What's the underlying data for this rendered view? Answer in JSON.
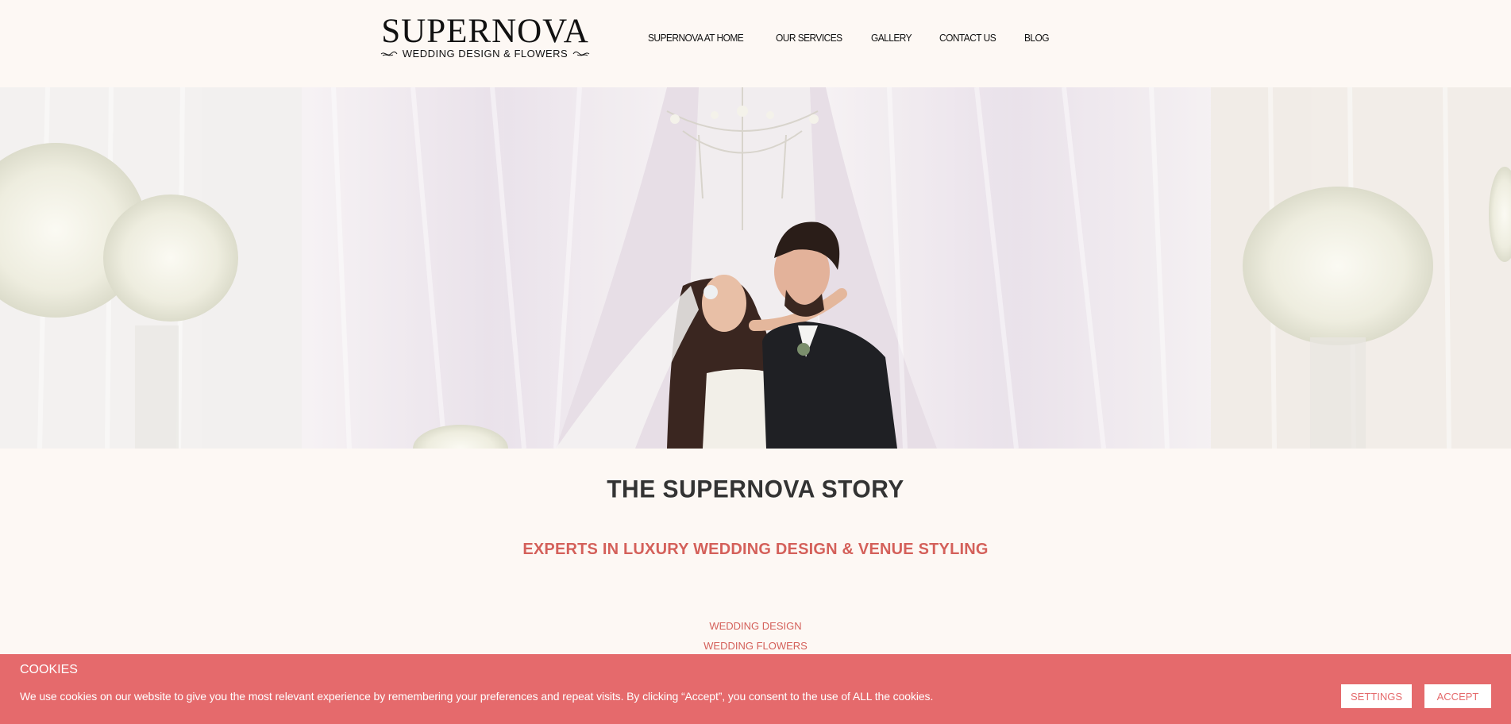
{
  "header": {
    "logo": {
      "main": "SUPERNOVA",
      "sub": "WEDDING DESIGN & FLOWERS"
    },
    "nav": [
      {
        "label": "SUPERNOVA AT HOME"
      },
      {
        "label": "OUR SERVICES"
      },
      {
        "label": "GALLERY"
      },
      {
        "label": "CONTACT US"
      },
      {
        "label": "BLOG"
      }
    ]
  },
  "hero": {
    "image": "wedding-couple-photo"
  },
  "main": {
    "title": "THE SUPERNOVA STORY",
    "subtitle": "EXPERTS IN LUXURY WEDDING DESIGN & VENUE STYLING",
    "services": [
      "WEDDING DESIGN",
      "WEDDING FLOWERS"
    ]
  },
  "cookie": {
    "title": "COOKIES",
    "text": "We use cookies on our website to give you the most relevant experience by remembering your preferences and repeat visits. By clicking “Accept”, you consent to the use of ALL the cookies.",
    "settings_label": "SETTINGS",
    "accept_label": "ACCEPT"
  },
  "colors": {
    "background": "#fdf8f4",
    "accent": "#d4605a",
    "cookie_bar": "#e56a6c"
  }
}
